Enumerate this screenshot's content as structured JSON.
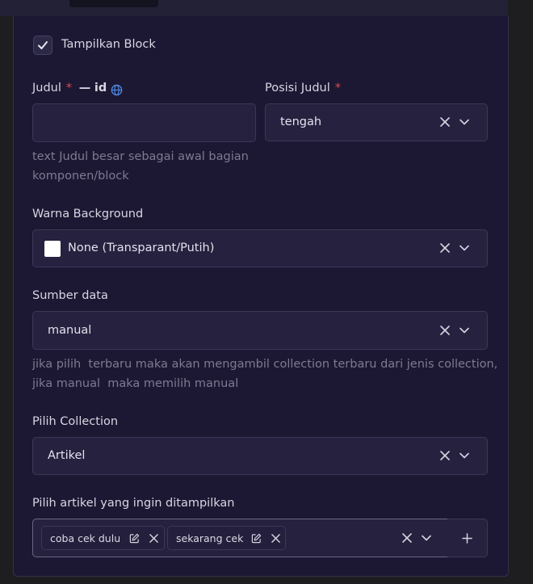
{
  "form": {
    "show_block": {
      "label": "Tampilkan Block",
      "checked": true
    },
    "judul": {
      "label": "Judul",
      "required_mark": "*",
      "locale_separator": "—",
      "locale": "id",
      "value": "",
      "help": "text Judul besar sebagai awal bagian komponen/block"
    },
    "posisi_judul": {
      "label": "Posisi Judul",
      "required_mark": "*",
      "value": "tengah"
    },
    "warna_background": {
      "label": "Warna Background",
      "value": "None (Transparant/Putih)",
      "swatch_color": "#ffffff"
    },
    "sumber_data": {
      "label": "Sumber data",
      "value": "manual",
      "help_line1": "jika pilih  terbaru maka akan mengambil collection terbaru dari jenis collection,",
      "help_line2": "jika manual  maka memilih manual"
    },
    "pilih_collection": {
      "label": "Pilih Collection",
      "value": "Artikel"
    },
    "pilih_artikel": {
      "label": "Pilih artikel yang ingin ditampilkan",
      "selected": [
        {
          "label": "coba cek dulu"
        },
        {
          "label": "sekarang cek"
        }
      ]
    }
  },
  "colors": {
    "background": "#1e1e21",
    "panel": "#1c1834",
    "field": "#25213f",
    "required": "#e5484d",
    "globe": "#4f8de8",
    "help_text": "#7d7a91"
  },
  "icons": {
    "check": "check-icon",
    "globe": "globe-icon",
    "clear": "close-icon",
    "dropdown": "chevron-down-icon",
    "edit": "edit-icon",
    "add": "plus-icon"
  }
}
